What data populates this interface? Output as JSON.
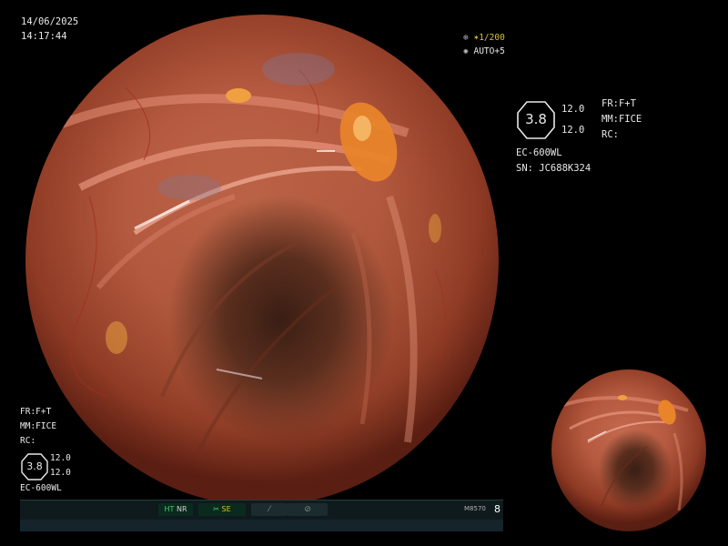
{
  "overlay": {
    "date": "14/06/2025",
    "time": "14:17:44",
    "shutter": "1/200",
    "exposure": "AUTO+5"
  },
  "info_panel": {
    "hex_value": "3.8",
    "value_top": "12.0",
    "value_bottom": "12.0",
    "fr": "FR:F+T",
    "mm": "MM:FICE",
    "rc": "RC:",
    "scope_model": "EC-600WL",
    "serial": "SN: JC688K324"
  },
  "lower_left": {
    "fr": "FR:F+T",
    "mm": "MM:FICE",
    "rc": "RC:",
    "hex_value": "3.8",
    "value_top": "12.0",
    "value_bottom": "12.0",
    "scope_model": "EC-600WL"
  },
  "status_bar": {
    "ht": "HT",
    "nr": "NR",
    "se": "SE",
    "model": "M8570",
    "page": "8"
  },
  "icons": {
    "shutter": "iris-icon",
    "exposure": "aperture-icon",
    "se": "scissor-icon",
    "slash": "slash-icon",
    "circle": "circle-icon"
  },
  "colors": {
    "mucosa": "#c56a4e",
    "lumen": "#3a1e14",
    "status_green": "#3ccf6a",
    "text": "#e8e8e8"
  }
}
